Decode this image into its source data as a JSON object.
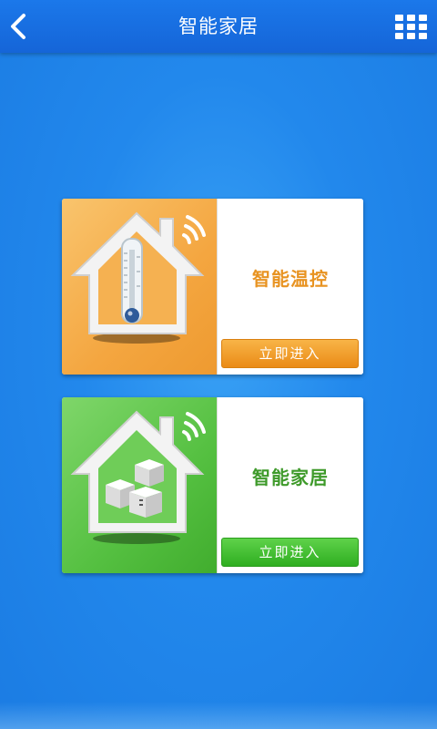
{
  "header": {
    "title": "智能家居",
    "back_icon": "chevron-left-icon",
    "menu_icon": "grid-menu-icon"
  },
  "cards": [
    {
      "label": "智能温控",
      "button_label": "立即进入",
      "icon": "house-thermometer-icon",
      "accent": "#f4a640"
    },
    {
      "label": "智能家居",
      "button_label": "立即进入",
      "icon": "house-devices-icon",
      "accent": "#55c041"
    }
  ],
  "colors": {
    "header_bg": "#1565d8",
    "page_bg": "#2288ec"
  }
}
